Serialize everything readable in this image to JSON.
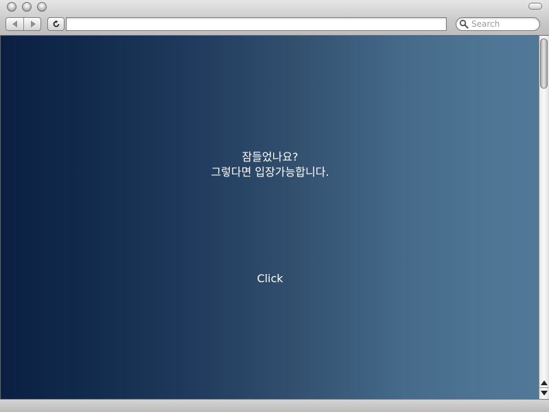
{
  "browser": {
    "search": {
      "placeholder": "Search"
    },
    "reload_glyph": "c",
    "address_value": ""
  },
  "content": {
    "message_line1": "잠들었나요?",
    "message_line2": "그렇다면 입장가능합니다.",
    "click_label": "Click"
  },
  "colors": {
    "gradient_left": "#0b1f41",
    "gradient_right": "#527899",
    "text": "#ffffff"
  },
  "icons": {
    "back": "back-arrow-icon",
    "forward": "forward-arrow-icon",
    "reload": "reload-icon",
    "search": "search-icon",
    "scroll_up": "scroll-up-arrow-icon",
    "scroll_down": "scroll-down-arrow-icon"
  }
}
